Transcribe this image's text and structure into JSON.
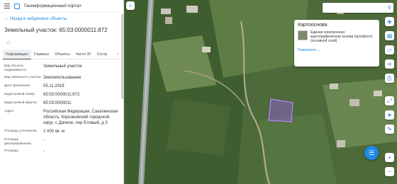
{
  "app": {
    "title": "Геоинформационный портал"
  },
  "back_link": "Назад в найденные объекты",
  "object_title": "Земельный участок: 65:03:0000011:872",
  "tabs": [
    "Информация",
    "Сервисы",
    "Объекты",
    "Части ЗУ",
    "Состр"
  ],
  "properties": [
    {
      "key": "Вид объекта недвижимости",
      "value": "Земельный участок"
    },
    {
      "key": "Вид земельного участка",
      "value": "Землепользование"
    },
    {
      "key": "Дата присвоения",
      "value": "05.11.2019"
    },
    {
      "key": "Кадастровый номер",
      "value": "65:03:0000011:872"
    },
    {
      "key": "Кадастровый квартал",
      "value": "65:03:0000011"
    },
    {
      "key": "Адрес",
      "value": "Российская Федерация, Сахалинская область, Корсаковский городской округ, с Дачное, пер Еловый, д 3"
    },
    {
      "key": "Площадь уточненная",
      "value": "1 000 кв. м"
    },
    {
      "key": "Площадь декларированная",
      "value": "-"
    },
    {
      "key": "Площадь",
      "value": "-"
    }
  ],
  "layers_panel": {
    "title": "Картооснова",
    "layer_name": "Единая электронная картографическая основа (ортофото)(основной слой)",
    "expand_label": "Развернуть"
  },
  "icons": {
    "collapse": "double-chevron-left-icon",
    "search": "search-icon",
    "fab": "chat-icon"
  },
  "colors": {
    "accent": "#1e88e5",
    "parcel": "#8a5fc7"
  }
}
